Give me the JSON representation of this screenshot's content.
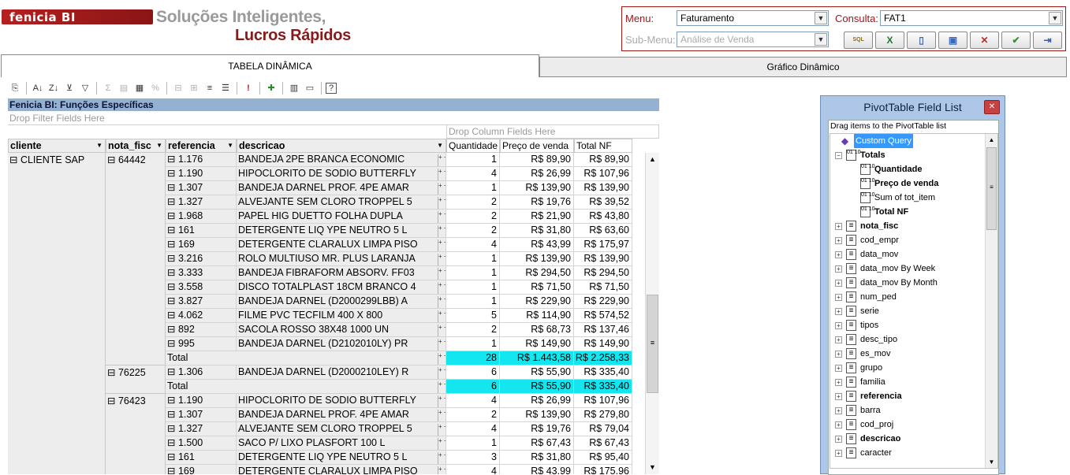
{
  "header": {
    "brand": "fenicia BI",
    "slogan_line1": "Soluções Inteligentes,",
    "slogan_line2": "Lucros Rápidos"
  },
  "menu": {
    "menu_label": "Menu:",
    "menu_value": "Faturamento",
    "submenu_label": "Sub-Menu:",
    "submenu_value": "Análise de Venda",
    "consulta_label": "Consulta:",
    "consulta_value": "FAT1",
    "buttons": [
      {
        "name": "sql-button",
        "icon": "sql-icon",
        "glyph": "SQL",
        "color": "#8a6a10"
      },
      {
        "name": "excel-button",
        "icon": "excel-icon",
        "glyph": "X",
        "color": "#1a7a2a"
      },
      {
        "name": "new-button",
        "icon": "document-icon",
        "glyph": "▯",
        "color": "#4a6aa0"
      },
      {
        "name": "save-button",
        "icon": "floppy-icon",
        "glyph": "▣",
        "color": "#3a6ac0"
      },
      {
        "name": "delete-button",
        "icon": "close-icon",
        "glyph": "✕",
        "color": "#d02020"
      },
      {
        "name": "confirm-button",
        "icon": "checkmark-icon",
        "glyph": "✔",
        "color": "#2a9a2a"
      },
      {
        "name": "exit-button",
        "icon": "exit-icon",
        "glyph": "⇥",
        "color": "#3060b0"
      }
    ]
  },
  "tabs": {
    "active": "TABELA DINÂMICA",
    "inactive": "Gráfico Dinâmico"
  },
  "pivot": {
    "title": "Fenicia BI: Funções Específicas",
    "drop_filter": "Drop Filter Fields Here",
    "drop_column": "Drop Column Fields Here",
    "row_headers": [
      "cliente",
      "nota_fisc",
      "referencia",
      "descricao"
    ],
    "data_headers": [
      "Quantidade",
      "Preço de venda",
      "Total NF"
    ],
    "cliente": "⊟ CLIENTE SAP",
    "groups": [
      {
        "nota": "⊟ 64442",
        "rows": [
          {
            "ref": "⊟ 1.176",
            "desc": "BANDEJA 2PE BRANCA ECONOMIC",
            "qtd": "1",
            "preco": "R$ 89,90",
            "total": "R$ 89,90"
          },
          {
            "ref": "⊟ 1.190",
            "desc": "HIPOCLORITO DE SODIO BUTTERFLY",
            "qtd": "4",
            "preco": "R$ 26,99",
            "total": "R$ 107,96"
          },
          {
            "ref": "⊟ 1.307",
            "desc": "BANDEJA DARNEL PROF. 4PE AMAR",
            "qtd": "1",
            "preco": "R$ 139,90",
            "total": "R$ 139,90"
          },
          {
            "ref": "⊟ 1.327",
            "desc": "ALVEJANTE SEM CLORO TROPPEL 5",
            "qtd": "2",
            "preco": "R$ 19,76",
            "total": "R$ 39,52"
          },
          {
            "ref": "⊟ 1.968",
            "desc": "PAPEL HIG DUETTO FOLHA DUPLA",
            "qtd": "2",
            "preco": "R$ 21,90",
            "total": "R$ 43,80"
          },
          {
            "ref": "⊟ 161",
            "desc": "DETERGENTE LIQ YPE NEUTRO 5 L",
            "qtd": "2",
            "preco": "R$ 31,80",
            "total": "R$ 63,60"
          },
          {
            "ref": "⊟ 169",
            "desc": "DETERGENTE CLARALUX LIMPA PISO",
            "qtd": "4",
            "preco": "R$ 43,99",
            "total": "R$ 175,97"
          },
          {
            "ref": "⊟ 3.216",
            "desc": "ROLO MULTIUSO MR. PLUS LARANJA",
            "qtd": "1",
            "preco": "R$ 139,90",
            "total": "R$ 139,90"
          },
          {
            "ref": "⊟ 3.333",
            "desc": "BANDEJA FIBRAFORM ABSORV. FF03",
            "qtd": "1",
            "preco": "R$ 294,50",
            "total": "R$ 294,50"
          },
          {
            "ref": "⊟ 3.558",
            "desc": "DISCO TOTALPLAST 18CM BRANCO 4",
            "qtd": "1",
            "preco": "R$ 71,50",
            "total": "R$ 71,50"
          },
          {
            "ref": "⊟ 3.827",
            "desc": "BANDEJA DARNEL (D2000299LBB) A",
            "qtd": "1",
            "preco": "R$ 229,90",
            "total": "R$ 229,90"
          },
          {
            "ref": "⊟ 4.062",
            "desc": "FILME PVC TECFILM 400 X 800",
            "qtd": "5",
            "preco": "R$ 114,90",
            "total": "R$ 574,52"
          },
          {
            "ref": "⊟ 892",
            "desc": "SACOLA ROSSO 38X48 1000 UN",
            "qtd": "2",
            "preco": "R$ 68,73",
            "total": "R$ 137,46"
          },
          {
            "ref": "⊟ 995",
            "desc": "BANDEJA DARNEL (D2102010LY) PR",
            "qtd": "1",
            "preco": "R$ 149,90",
            "total": "R$ 149,90"
          }
        ],
        "total": {
          "label": "Total",
          "qtd": "28",
          "preco": "R$ 1.443,58",
          "total": "R$ 2.258,33"
        }
      },
      {
        "nota": "⊟ 76225",
        "rows": [
          {
            "ref": "⊟ 1.306",
            "desc": "BANDEJA DARNEL (D2000210LEY) R",
            "qtd": "6",
            "preco": "R$ 55,90",
            "total": "R$ 335,40"
          }
        ],
        "total": {
          "label": "Total",
          "qtd": "6",
          "preco": "R$ 55,90",
          "total": "R$ 335,40"
        }
      },
      {
        "nota": "⊟ 76423",
        "rows": [
          {
            "ref": "⊟ 1.190",
            "desc": "HIPOCLORITO DE SODIO BUTTERFLY",
            "qtd": "4",
            "preco": "R$ 26,99",
            "total": "R$ 107,96"
          },
          {
            "ref": "⊟ 1.307",
            "desc": "BANDEJA DARNEL PROF. 4PE AMAR",
            "qtd": "2",
            "preco": "R$ 139,90",
            "total": "R$ 279,80"
          },
          {
            "ref": "⊟ 1.327",
            "desc": "ALVEJANTE SEM CLORO TROPPEL 5",
            "qtd": "4",
            "preco": "R$ 19,76",
            "total": "R$ 79,04"
          },
          {
            "ref": "⊟ 1.500",
            "desc": "SACO P/ LIXO PLASFORT 100 L",
            "qtd": "1",
            "preco": "R$ 67,43",
            "total": "R$ 67,43"
          },
          {
            "ref": "⊟ 161",
            "desc": "DETERGENTE LIQ YPE NEUTRO 5 L",
            "qtd": "3",
            "preco": "R$ 31,80",
            "total": "R$ 95,40"
          },
          {
            "ref": "⊟ 169",
            "desc": "DETERGENTE CLARALUX LIMPA PISO",
            "qtd": "4",
            "preco": "R$ 43,99",
            "total": "R$ 175,96"
          }
        ],
        "total": null
      }
    ]
  },
  "field_list": {
    "title": "PivotTable Field List",
    "instructions": "Drag items to the PivotTable list",
    "nodes": [
      {
        "label": "Custom Query",
        "level": 0,
        "kind": "cube",
        "selected": true
      },
      {
        "label": "Totals",
        "level": 1,
        "kind": "totals",
        "bold": true,
        "pm": "−"
      },
      {
        "label": "Quantidade",
        "level": 2,
        "kind": "measure",
        "bold": true
      },
      {
        "label": "Preço de venda",
        "level": 2,
        "kind": "measure",
        "bold": true
      },
      {
        "label": "Sum of tot_item",
        "level": 2,
        "kind": "measure"
      },
      {
        "label": "Total NF",
        "level": 2,
        "kind": "measure",
        "bold": true
      },
      {
        "label": "nota_fisc",
        "level": 1,
        "kind": "dim",
        "bold": true,
        "pm": "+"
      },
      {
        "label": "cod_empr",
        "level": 1,
        "kind": "dim",
        "pm": "+"
      },
      {
        "label": "data_mov",
        "level": 1,
        "kind": "dim",
        "pm": "+"
      },
      {
        "label": "data_mov By Week",
        "level": 1,
        "kind": "dim",
        "pm": "+"
      },
      {
        "label": "data_mov By Month",
        "level": 1,
        "kind": "dim",
        "pm": "+"
      },
      {
        "label": "num_ped",
        "level": 1,
        "kind": "dim",
        "pm": "+"
      },
      {
        "label": "serie",
        "level": 1,
        "kind": "dim",
        "pm": "+"
      },
      {
        "label": "tipos",
        "level": 1,
        "kind": "dim",
        "pm": "+"
      },
      {
        "label": "desc_tipo",
        "level": 1,
        "kind": "dim",
        "pm": "+"
      },
      {
        "label": "es_mov",
        "level": 1,
        "kind": "dim",
        "pm": "+"
      },
      {
        "label": "grupo",
        "level": 1,
        "kind": "dim",
        "pm": "+"
      },
      {
        "label": "familia",
        "level": 1,
        "kind": "dim",
        "pm": "+"
      },
      {
        "label": "referencia",
        "level": 1,
        "kind": "dim",
        "bold": true,
        "pm": "+"
      },
      {
        "label": "barra",
        "level": 1,
        "kind": "dim",
        "pm": "+"
      },
      {
        "label": "cod_proj",
        "level": 1,
        "kind": "dim",
        "pm": "+"
      },
      {
        "label": "descricao",
        "level": 1,
        "kind": "dim",
        "bold": true,
        "pm": "+"
      },
      {
        "label": "caracter",
        "level": 1,
        "kind": "dim",
        "pm": "+"
      }
    ]
  }
}
